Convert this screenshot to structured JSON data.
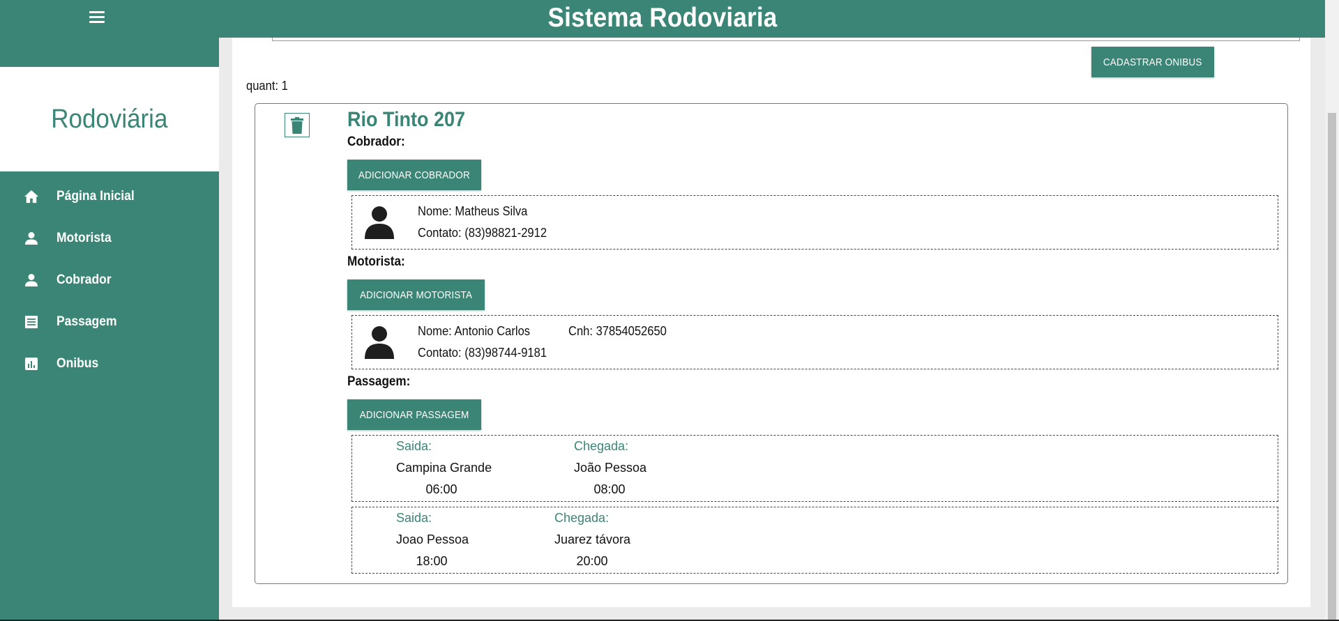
{
  "header": {
    "title": "Sistema Rodoviaria",
    "menu_icon": "hamburger-menu-icon"
  },
  "sidebar": {
    "brand": "Rodoviária",
    "items": [
      {
        "label": "Página Inicial",
        "icon": "home-icon"
      },
      {
        "label": "Motorista",
        "icon": "person-icon"
      },
      {
        "label": "Cobrador",
        "icon": "person-icon"
      },
      {
        "label": "Passagem",
        "icon": "receipt-icon"
      },
      {
        "label": "Onibus",
        "icon": "chart-icon"
      }
    ]
  },
  "main": {
    "cadastrar_button": "CADASTRAR ONIBUS",
    "quant_label": "quant: 1",
    "bus": {
      "name": "Rio Tinto 207",
      "cobrador_label": "Cobrador:",
      "add_cobrador_button": "ADICIONAR COBRADOR",
      "cobrador": {
        "nome": "Nome: Matheus Silva",
        "contato": "Contato: (83)98821-2912"
      },
      "motorista_label": "Motorista:",
      "add_motorista_button": "ADICIONAR MOTORISTA",
      "motorista": {
        "nome": "Nome: Antonio Carlos",
        "cnh": "Cnh: 37854052650",
        "contato": "Contato: (83)98744-9181"
      },
      "passagem_label": "Passagem:",
      "add_passagem_button": "ADICIONAR PASSAGEM",
      "passagens": [
        {
          "saida_label": "Saida:",
          "saida_local": "Campina Grande",
          "saida_hora": "06:00",
          "chegada_label": "Chegada:",
          "chegada_local": "João Pessoa",
          "chegada_hora": "08:00"
        },
        {
          "saida_label": "Saida:",
          "saida_local": "Joao Pessoa",
          "saida_hora": "18:00",
          "chegada_label": "Chegada:",
          "chegada_local": "Juarez távora",
          "chegada_hora": "20:00"
        }
      ]
    }
  },
  "colors": {
    "primary": "#3a8575",
    "background": "#ebebeb",
    "card": "#ffffff"
  }
}
